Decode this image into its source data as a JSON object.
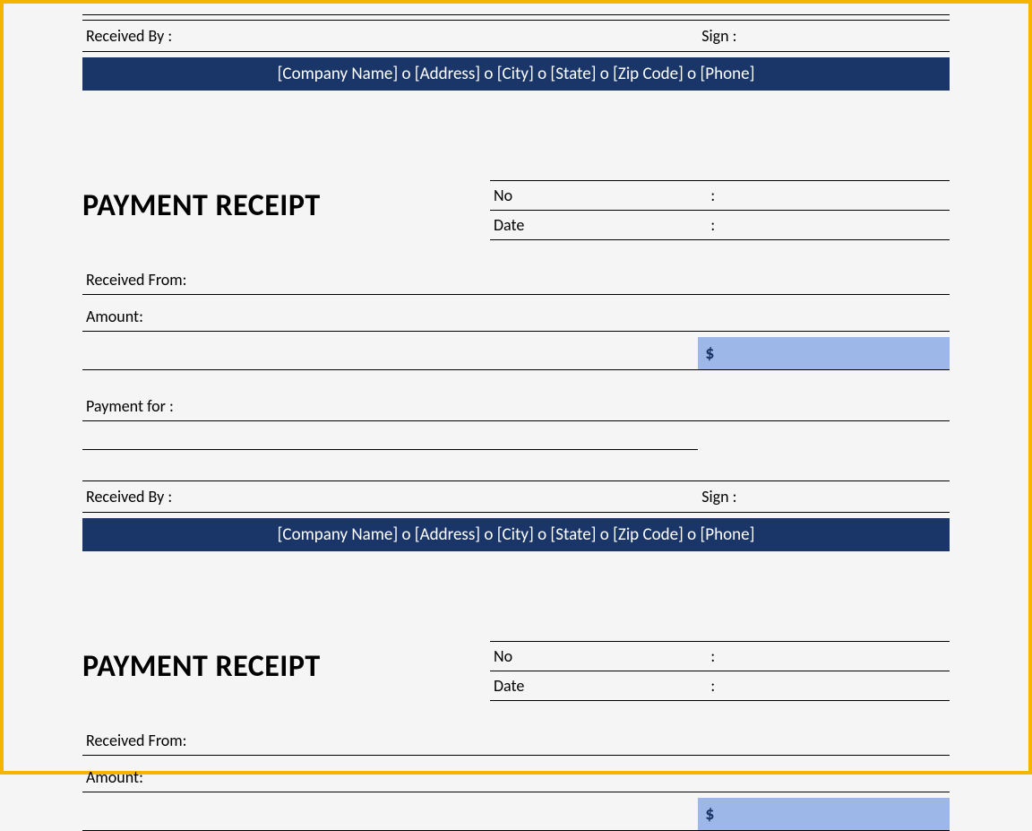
{
  "top": {
    "received_by": "Received By :",
    "sign": "Sign :",
    "footer": "[Company Name] o [Address] o [City] o [State] o [Zip Code] o [Phone]"
  },
  "receipt1": {
    "title": "PAYMENT RECEIPT",
    "no_label": "No",
    "date_label": "Date",
    "colon": ":",
    "received_from": "Received From:",
    "amount_label": "Amount:",
    "currency": "$",
    "payment_for": "Payment for :",
    "received_by": "Received By :",
    "sign": "Sign :",
    "footer": "[Company Name] o [Address] o [City] o [State] o [Zip Code] o [Phone]"
  },
  "receipt2": {
    "title": "PAYMENT RECEIPT",
    "no_label": "No",
    "date_label": "Date",
    "colon": ":",
    "received_from": "Received From:",
    "amount_label": "Amount:",
    "currency": "$"
  }
}
